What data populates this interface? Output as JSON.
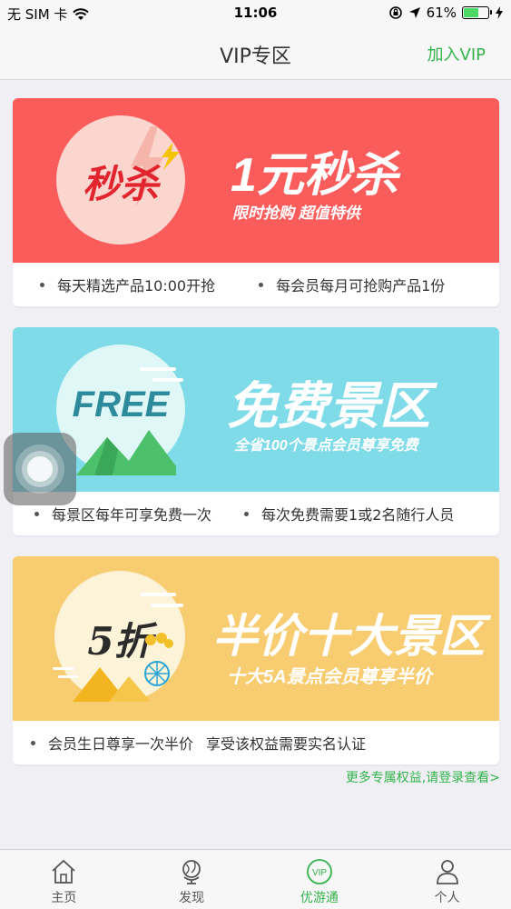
{
  "status_bar": {
    "carrier": "无 SIM 卡",
    "time": "11:06",
    "battery": "61%",
    "battery_level": 0.61
  },
  "nav": {
    "title": "VIP专区",
    "action": "加入VIP"
  },
  "cards": [
    {
      "circle_text": "秒杀",
      "title": "1元秒杀",
      "subtitle": "限时抢购   超值特供",
      "bullets": [
        "每天精选产品10:00开抢",
        "每会员每月可抢购产品1份"
      ],
      "color": "#fa5c5c"
    },
    {
      "circle_text": "FREE",
      "title": "免费景区",
      "subtitle": "全省100个景点会员尊享免费",
      "bullets": [
        "每景区每年可享免费一次",
        "每次免费需要1或2名随行人员"
      ],
      "color": "#7fdbe8"
    },
    {
      "circle_text": "5折",
      "title": "半价十大景区",
      "subtitle": "十大5A景点会员尊享半价",
      "bullets": [
        "会员生日尊享一次半价",
        "享受该权益需要实名认证"
      ],
      "color": "#f8cc70"
    }
  ],
  "more_link": "更多专属权益,请登录查看>",
  "tabs": [
    {
      "label": "主页",
      "icon": "home-icon"
    },
    {
      "label": "发现",
      "icon": "globe-icon"
    },
    {
      "label": "优游通",
      "icon": "vip-icon"
    },
    {
      "label": "个人",
      "icon": "person-icon"
    }
  ],
  "colors": {
    "accent": "#34b34c"
  }
}
